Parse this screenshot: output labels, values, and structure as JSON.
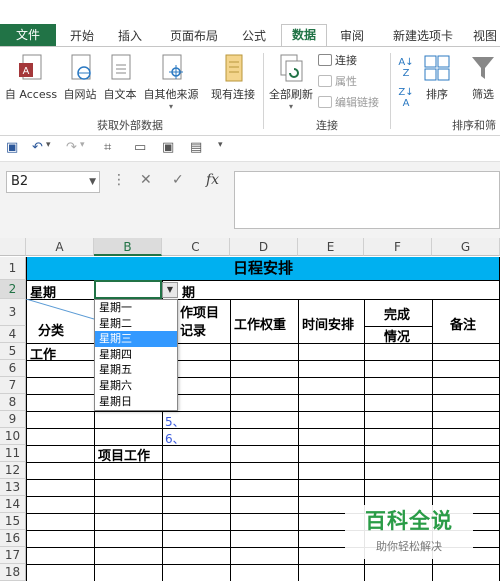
{
  "ribbon_tabs": [
    "文件",
    "开始",
    "插入",
    "页面布局",
    "公式",
    "数据",
    "审阅",
    "新建选项卡",
    "视图"
  ],
  "active_tab": "数据",
  "ribbon": {
    "get_external": {
      "access": "自 Access",
      "web": "自网站",
      "text": "自文本",
      "other": "自其他来源",
      "existing": "现有连接",
      "label": "获取外部数据"
    },
    "connections": {
      "refresh_all": "全部刷新",
      "connections": "连接",
      "properties": "属性",
      "edit_links": "编辑链接",
      "label": "连接"
    },
    "sort_filter": {
      "sort": "排序",
      "filter": "筛选",
      "label": "排序和筛"
    }
  },
  "formula_bar": {
    "name_box": "B2",
    "fx": "fx",
    "content": ""
  },
  "columns": [
    "A",
    "B",
    "C",
    "D",
    "E",
    "F",
    "G"
  ],
  "selected_column": "B",
  "rows": [
    "1",
    "2",
    "3",
    "4",
    "5",
    "6",
    "7",
    "8",
    "9",
    "10",
    "11",
    "12",
    "13",
    "14",
    "15",
    "16",
    "17",
    "18"
  ],
  "selected_row": "2",
  "sheet": {
    "title": "日程安排",
    "a2": "星期",
    "c2": "期",
    "a4": "分类",
    "c3": "作项目",
    "c4": "记录",
    "d3": "工作权重",
    "e3": "时间安排",
    "f3": "完成",
    "f4": "情况",
    "g3": "备注",
    "a5": "工作",
    "b11": "项目工作",
    "c9": "5、",
    "c10": "6、"
  },
  "dropdown_options": [
    "星期一",
    "星期二",
    "星期三",
    "星期四",
    "星期五",
    "星期六",
    "星期日"
  ],
  "dropdown_selected_index": 2,
  "watermark": {
    "brand": "百科全说",
    "tagline": "助你轻松解决"
  }
}
